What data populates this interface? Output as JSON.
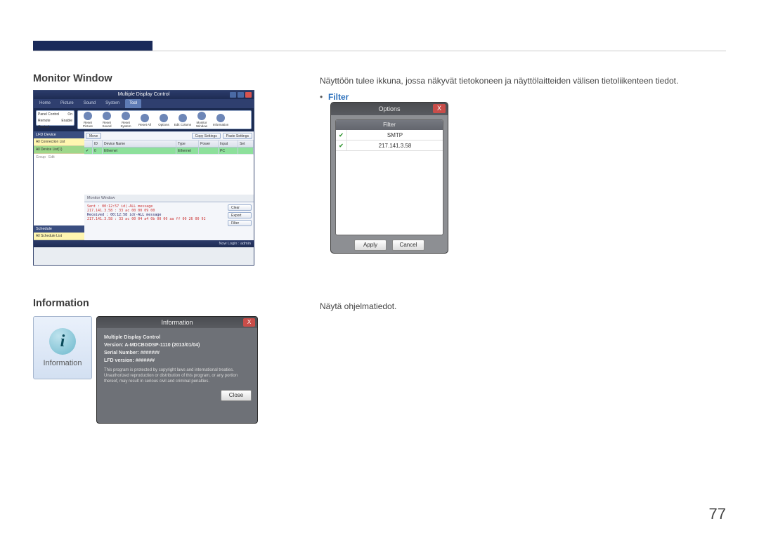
{
  "page_number": "77",
  "sections": {
    "monitor_window": {
      "title": "Monitor Window",
      "description": "Näyttöön tulee ikkuna, jossa näkyvät tietokoneen ja näyttölaitteiden välisen tietoliikenteen tiedot.",
      "filter_bullet": "Filter"
    },
    "information": {
      "title": "Information",
      "description": "Näytä ohjelmatiedot."
    }
  },
  "mdc": {
    "window_title": "Multiple Display Control",
    "tabs": [
      "Home",
      "Picture",
      "Sound",
      "System",
      "Tool"
    ],
    "active_tab": "Tool",
    "panel_control": {
      "label": "Panel Control",
      "value": "On"
    },
    "remote_control": {
      "label": "Remote Control",
      "value": "Enable"
    },
    "tools": [
      "Reset Picture",
      "Reset Sound",
      "Reset System",
      "Reset All",
      "Options",
      "Edit Column",
      "Monitor Window",
      "Information"
    ],
    "row_buttons": [
      "Move",
      "Copy Settings",
      "Paste Settings"
    ],
    "side": {
      "lfd_header": "LFD Device",
      "conn_list": "All Connection List",
      "device_all": "All Device List(1)",
      "group": "Group",
      "edit": "Edit",
      "schedule_header": "Schedule",
      "schedule_list": "All Schedule List"
    },
    "grid": {
      "headers": [
        "",
        "ID",
        "Device Name",
        "Type",
        "Power",
        "Input",
        "Set"
      ],
      "row": {
        "id": "0",
        "name": "Ethernet",
        "type": "Ethernet",
        "power": "",
        "input": "PC",
        "set": ""
      }
    },
    "monitor": {
      "label": "Monitor Window",
      "lines": [
        "Sent : 00:12:57 id(-ALL message",
        "217.141.3.58 : 33 ac 00 00 09 00",
        "Received : 00:12:58 id(-ALL message",
        "217.141.3.58 : 33 ac 00 04 a4 0b 00 00 aa ff 00 26 00 92"
      ],
      "buttons": [
        "Clear",
        "Export",
        "Filter"
      ]
    },
    "footer": "Now Login : admin"
  },
  "filter_dialog": {
    "title": "Options",
    "close": "X",
    "column": "Filter",
    "rows": [
      "SMTP",
      "217.141.3.58"
    ],
    "apply": "Apply",
    "cancel": "Cancel"
  },
  "info_tile": {
    "glyph": "i",
    "label": "Information"
  },
  "info_dialog": {
    "title": "Information",
    "close": "X",
    "product": "Multiple Display Control",
    "version_label": "Version:",
    "version": "A-MDCBGDSP-1110 (2013/01/04)",
    "serial_label": "Serial Number:",
    "serial": "#######",
    "lfd_label": "LFD version:",
    "lfd": "#######",
    "legal": "This program is protected by copyright laws and international treaties. Unauthorized reproduction or distribution of this program, or any portion thereof, may result in serious civil and criminal penalties.",
    "close_btn": "Close"
  }
}
